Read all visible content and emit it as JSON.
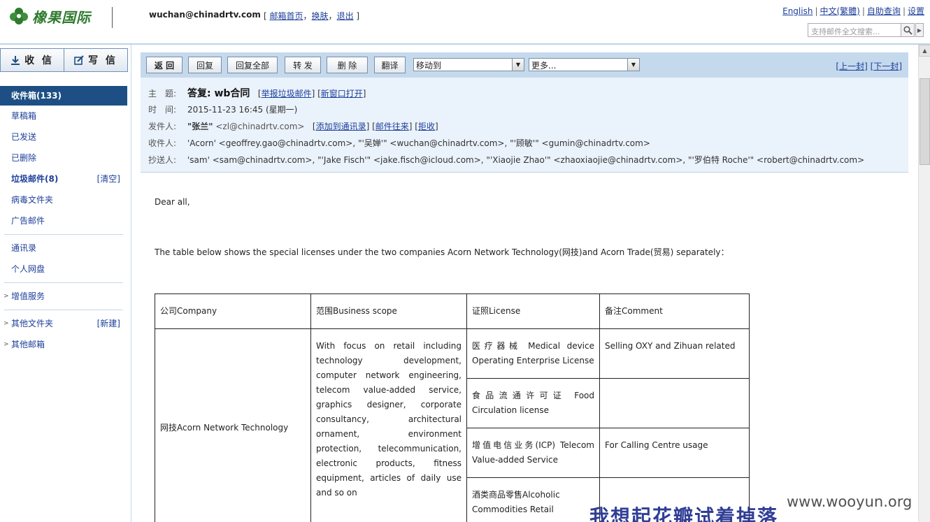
{
  "header": {
    "brand": "橡果国际",
    "user_email": "wuchan@chinadrtv.com",
    "top_links": [
      "邮箱首页",
      "换肤",
      "退出"
    ],
    "right_links": [
      "English",
      "中文(繁體)",
      "自助查询",
      "设置"
    ],
    "search_placeholder": "支持邮件全文搜索..."
  },
  "sidebar": {
    "receive_label": "收 信",
    "compose_label": "写 信",
    "folders": [
      {
        "label": "收件箱(133)"
      },
      {
        "label": "草稿箱"
      },
      {
        "label": "已发送"
      },
      {
        "label": "已删除"
      },
      {
        "label": "垃圾邮件(8)",
        "aux": "[清空]"
      },
      {
        "label": "病毒文件夹"
      },
      {
        "label": "广告邮件"
      }
    ],
    "tools": [
      {
        "label": "通讯录"
      },
      {
        "label": "个人网盘"
      }
    ],
    "value_added": "增值服务",
    "other_folders": "其他文件夹",
    "other_folders_aux": "[新建]",
    "other_mail": "其他邮箱"
  },
  "toolbar": {
    "back": "返 回",
    "reply": "回复",
    "reply_all": "回复全部",
    "forward": "转 发",
    "delete": "删  除",
    "translate": "翻译",
    "move_to": "移动到",
    "more": "更多...",
    "prev": "上一封",
    "next": "下一封"
  },
  "mail": {
    "subject_label": "主　题:",
    "subject": "答复: wb合同",
    "subject_links": [
      "举报垃圾邮件",
      "新窗口打开"
    ],
    "time_label": "时　间:",
    "time": "2015-11-23 16:45 (星期一)",
    "from_label": "发件人:",
    "from_name": "\"张兰\"",
    "from_email": "<zl@chinadrtv.com>",
    "from_links": [
      "添加到通讯录",
      "邮件往来",
      "拒收"
    ],
    "to_label": "收件人:",
    "to": "'Acorn' <geoffrey.gao@chinadrtv.com>, \"'吴婵'\" <wuchan@chinadrtv.com>, \"'顾敏'\" <gumin@chinadrtv.com>",
    "cc_label": "抄送人:",
    "cc": "'sam' <sam@chinadrtv.com>, \"'Jake Fisch'\" <jake.fisch@icloud.com>, \"'Xiaojie Zhao'\" <zhaoxiaojie@chinadrtv.com>, \"'罗伯特 Roche'\" <robert@chinadrtv.com>"
  },
  "body": {
    "greeting": "Dear all,",
    "intro": "The table below shows the special licenses under the two companies Acorn Network Technology(网技)and Acorn Trade(贸易) separately：",
    "table": {
      "headers": [
        "公司Company",
        "范围Business scope",
        "证照License",
        "备注Comment"
      ],
      "company": "网技Acorn Network Technology",
      "scope": "With focus on retail including technology development, computer network engineering, telecom value-added service, graphics designer, corporate consultancy, architectural ornament, environment protection, telecommunication, electronic products, fitness equipment, articles of daily use and so on",
      "rows": [
        {
          "license": "医疗器械 Medical device Operating Enterprise License",
          "comment": "Selling OXY and Zihuan related"
        },
        {
          "license": "食品流通许可证 Food Circulation license",
          "comment": ""
        },
        {
          "license": "增值电信业务(ICP) Telecom Value-added Service",
          "comment": "For Calling Centre usage"
        },
        {
          "license": "酒类商品零售Alcoholic Commodities Retail",
          "comment": ""
        }
      ]
    }
  },
  "watermark": "www.wooyun.org",
  "overlay_text": "我想起花瓣试着掉落",
  "colors": {
    "active_folder": "#1d4f84",
    "toolbar_bg": "#c5d9ec",
    "header_bg": "#eaf2fb",
    "link": "#1d3f9a",
    "brand_green": "#2e7a2e"
  }
}
